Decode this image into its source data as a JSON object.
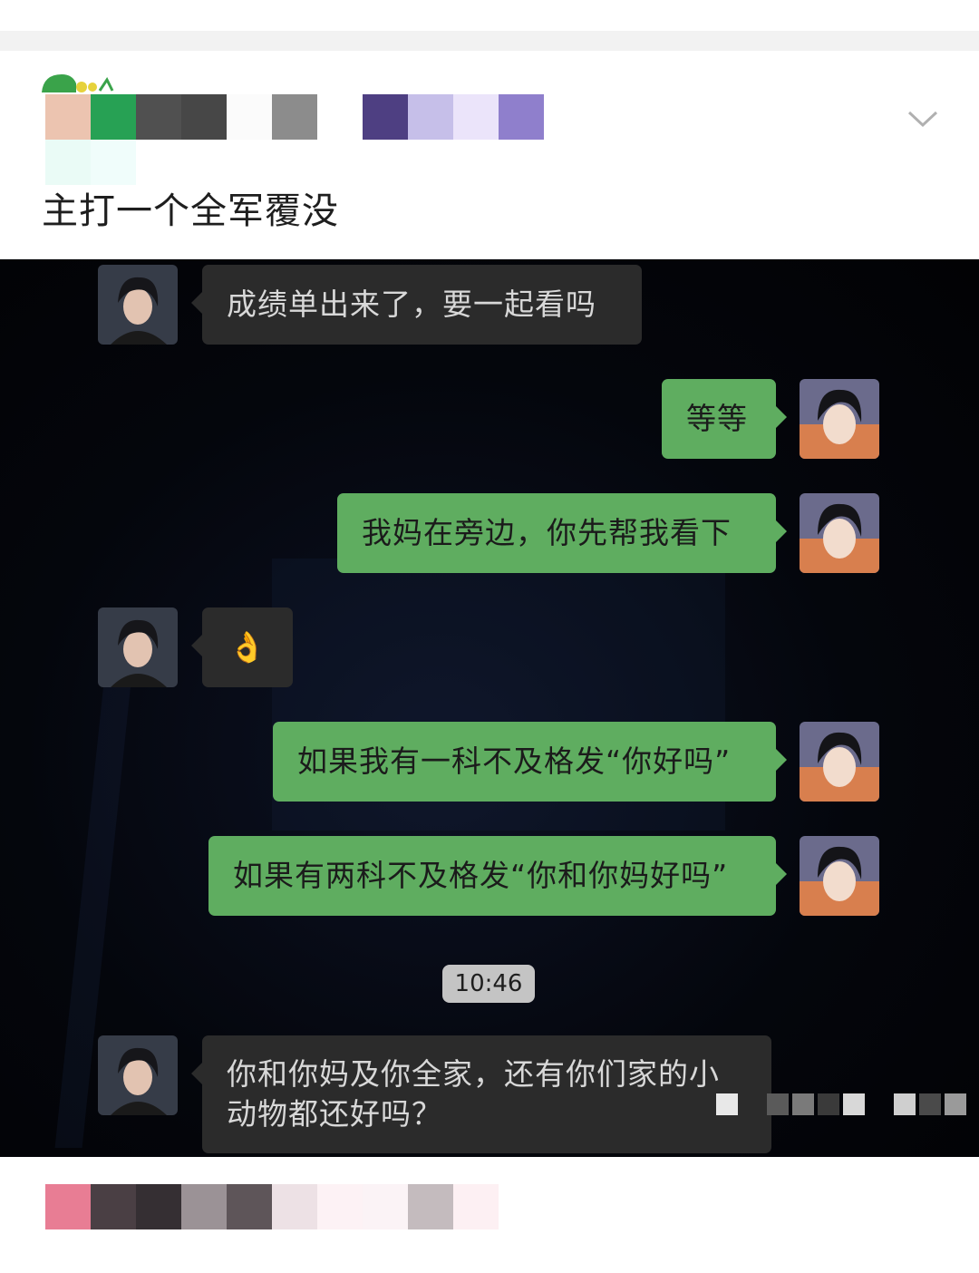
{
  "post": {
    "title": "主打一个全军覆没",
    "badge_icon": "caterpillar-badge-icon",
    "collapse_icon": "chevron-down-icon"
  },
  "chat": {
    "messages": [
      {
        "side": "left",
        "text": "成绩单出来了，要一起看吗"
      },
      {
        "side": "right",
        "text": "等等"
      },
      {
        "side": "right",
        "text": "我妈在旁边，你先帮我看下"
      },
      {
        "side": "left",
        "emoji": "👌"
      },
      {
        "side": "right",
        "text": "如果我有一科不及格发“你好吗”"
      },
      {
        "side": "right",
        "text": "如果有两科不及格发“你和你妈好吗”"
      },
      {
        "side": "left",
        "text": "你和你妈及你全家，还有你们家的小动物都还好吗？"
      }
    ],
    "timestamp": "10:46"
  },
  "colors": {
    "bubble_right": "#5fad60",
    "bubble_left": "#2b2b2b",
    "chat_background": "#04060c"
  }
}
